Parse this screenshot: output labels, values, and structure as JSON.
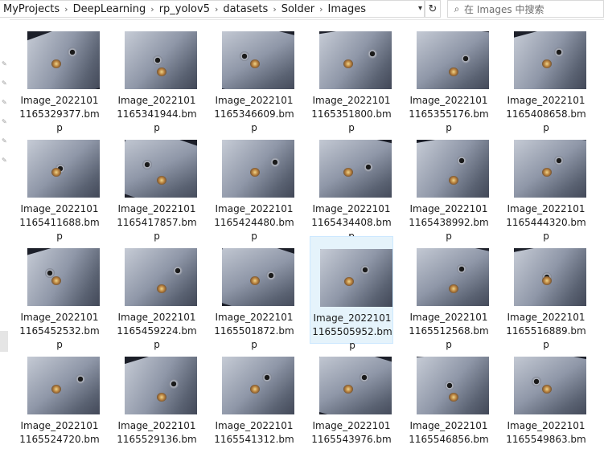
{
  "breadcrumb": [
    "MyProjects",
    "DeepLearning",
    "rp_yolov5",
    "datasets",
    "Solder",
    "Images"
  ],
  "search": {
    "placeholder": "在 Images 中搜索"
  },
  "files": [
    {
      "line1": "Image_2022101",
      "line2": "1165329377.bm",
      "line3": "p"
    },
    {
      "line1": "Image_2022101",
      "line2": "1165341944.bm",
      "line3": "p"
    },
    {
      "line1": "Image_2022101",
      "line2": "1165346609.bm",
      "line3": "p"
    },
    {
      "line1": "Image_2022101",
      "line2": "1165351800.bm",
      "line3": "p"
    },
    {
      "line1": "Image_2022101",
      "line2": "1165355176.bm",
      "line3": "p"
    },
    {
      "line1": "Image_2022101",
      "line2": "1165408658.bm",
      "line3": "p"
    },
    {
      "line1": "Image_2022101",
      "line2": "1165411688.bm",
      "line3": "p"
    },
    {
      "line1": "Image_2022101",
      "line2": "1165417857.bm",
      "line3": "p"
    },
    {
      "line1": "Image_2022101",
      "line2": "1165424480.bm",
      "line3": "p"
    },
    {
      "line1": "Image_2022101",
      "line2": "1165434408.bm",
      "line3": "p"
    },
    {
      "line1": "Image_2022101",
      "line2": "1165438992.bm",
      "line3": "p"
    },
    {
      "line1": "Image_2022101",
      "line2": "1165444320.bm",
      "line3": "p"
    },
    {
      "line1": "Image_2022101",
      "line2": "1165452532.bm",
      "line3": "p"
    },
    {
      "line1": "Image_2022101",
      "line2": "1165459224.bm",
      "line3": "p"
    },
    {
      "line1": "Image_2022101",
      "line2": "1165501872.bm",
      "line3": "p"
    },
    {
      "line1": "Image_2022101",
      "line2": "1165505952.bm",
      "line3": "p",
      "selected": true
    },
    {
      "line1": "Image_2022101",
      "line2": "1165512568.bm",
      "line3": "p"
    },
    {
      "line1": "Image_2022101",
      "line2": "1165516889.bm",
      "line3": "p"
    },
    {
      "line1": "Image_2022101",
      "line2": "1165524720.bm",
      "line3": ""
    },
    {
      "line1": "Image_2022101",
      "line2": "1165529136.bm",
      "line3": ""
    },
    {
      "line1": "Image_2022101",
      "line2": "1165541312.bm",
      "line3": ""
    },
    {
      "line1": "Image_2022101",
      "line2": "1165543976.bm",
      "line3": ""
    },
    {
      "line1": "Image_2022101",
      "line2": "1165546856.bm",
      "line3": ""
    },
    {
      "line1": "Image_2022101",
      "line2": "1165549863.bm",
      "line3": ""
    }
  ]
}
